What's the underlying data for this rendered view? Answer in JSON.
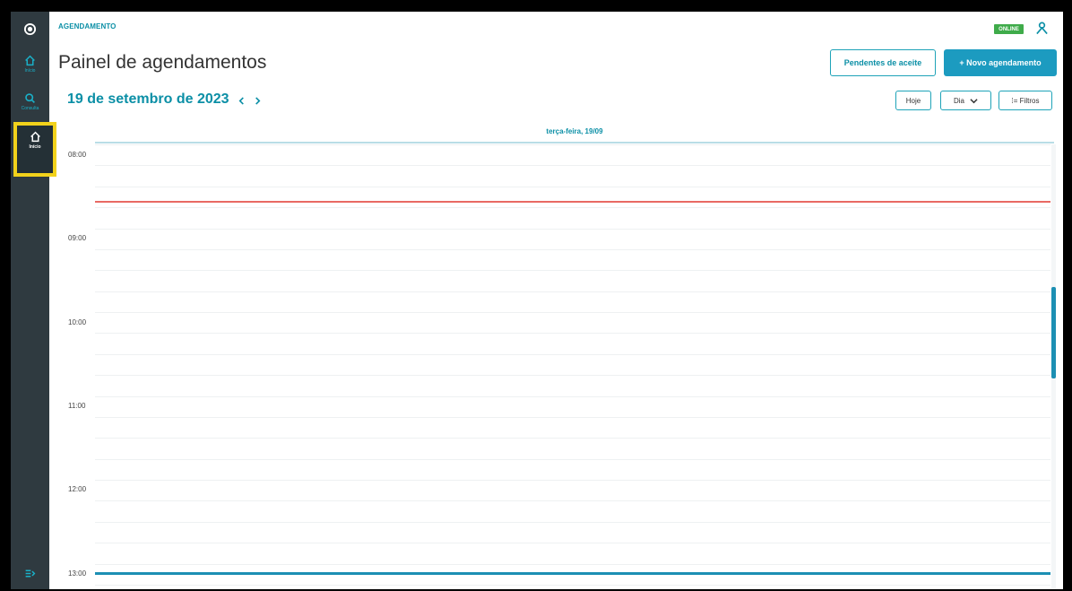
{
  "sidebar": {
    "logo_icon": "logo-icon",
    "items": [
      {
        "label": "Início",
        "icon": "home-icon"
      },
      {
        "label": "Consulta",
        "icon": "search-icon"
      },
      {
        "label": "Início",
        "icon": "home-icon",
        "active": true
      }
    ],
    "collapse_icon": "collapse-menu-icon"
  },
  "header": {
    "section": "AGENDAMENTO",
    "status_badge": "ONLINE",
    "user_icon": "user-icon",
    "title": "Painel de agendamentos",
    "pending_button": "Pendentes de aceite",
    "new_button": "+ Novo agendamento"
  },
  "toolbar": {
    "date": "19 de setembro de 2023",
    "today_button": "Hoje",
    "view_select": "Dia",
    "filters_button": "⁞= Filtros"
  },
  "calendar": {
    "day_header": "terça-feira, 19/09",
    "hours": [
      "08:00",
      "09:00",
      "10:00",
      "11:00",
      "12:00",
      "13:00"
    ]
  },
  "colors": {
    "sidebar_bg": "#2f3a40",
    "accent": "#0b8fa6",
    "primary_button": "#1c9bc0",
    "online_badge": "#3fab4a",
    "now_line": "#e86a63",
    "highlight": "#f2d21b"
  }
}
